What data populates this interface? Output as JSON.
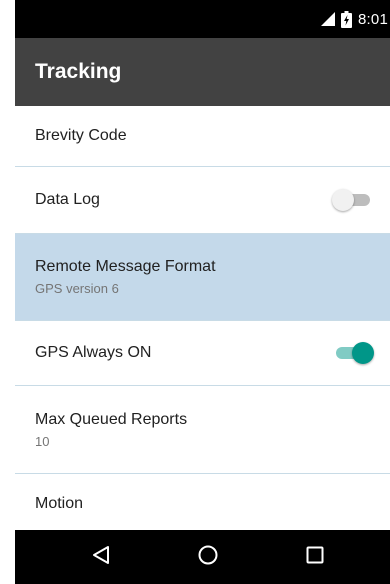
{
  "status_bar": {
    "time": "8:01",
    "signal_icon": "signal-icon",
    "battery_icon": "battery-icon"
  },
  "app_bar": {
    "title": "Tracking"
  },
  "settings": {
    "brevity_code": {
      "title": "Brevity Code"
    },
    "data_log": {
      "title": "Data Log",
      "enabled": false
    },
    "remote_message_format": {
      "title": "Remote Message Format",
      "summary": "GPS version 6",
      "selected": true
    },
    "gps_always_on": {
      "title": "GPS Always ON",
      "enabled": true
    },
    "max_queued_reports": {
      "title": "Max Queued Reports",
      "summary": "10"
    },
    "motion": {
      "title": "Motion"
    }
  },
  "nav_bar": {
    "back_icon": "back-triangle-icon",
    "home_icon": "home-circle-icon",
    "recents_icon": "recents-square-icon"
  },
  "colors": {
    "status_bar": "#000000",
    "app_bar": "#424242",
    "selected_row": "#c4d9ea",
    "divider": "#c8dbe6",
    "toggle_on_thumb": "#009688",
    "toggle_on_track": "#80cbc4",
    "toggle_off_thumb": "#f1f1f1",
    "toggle_off_track": "#bdbdbd"
  }
}
